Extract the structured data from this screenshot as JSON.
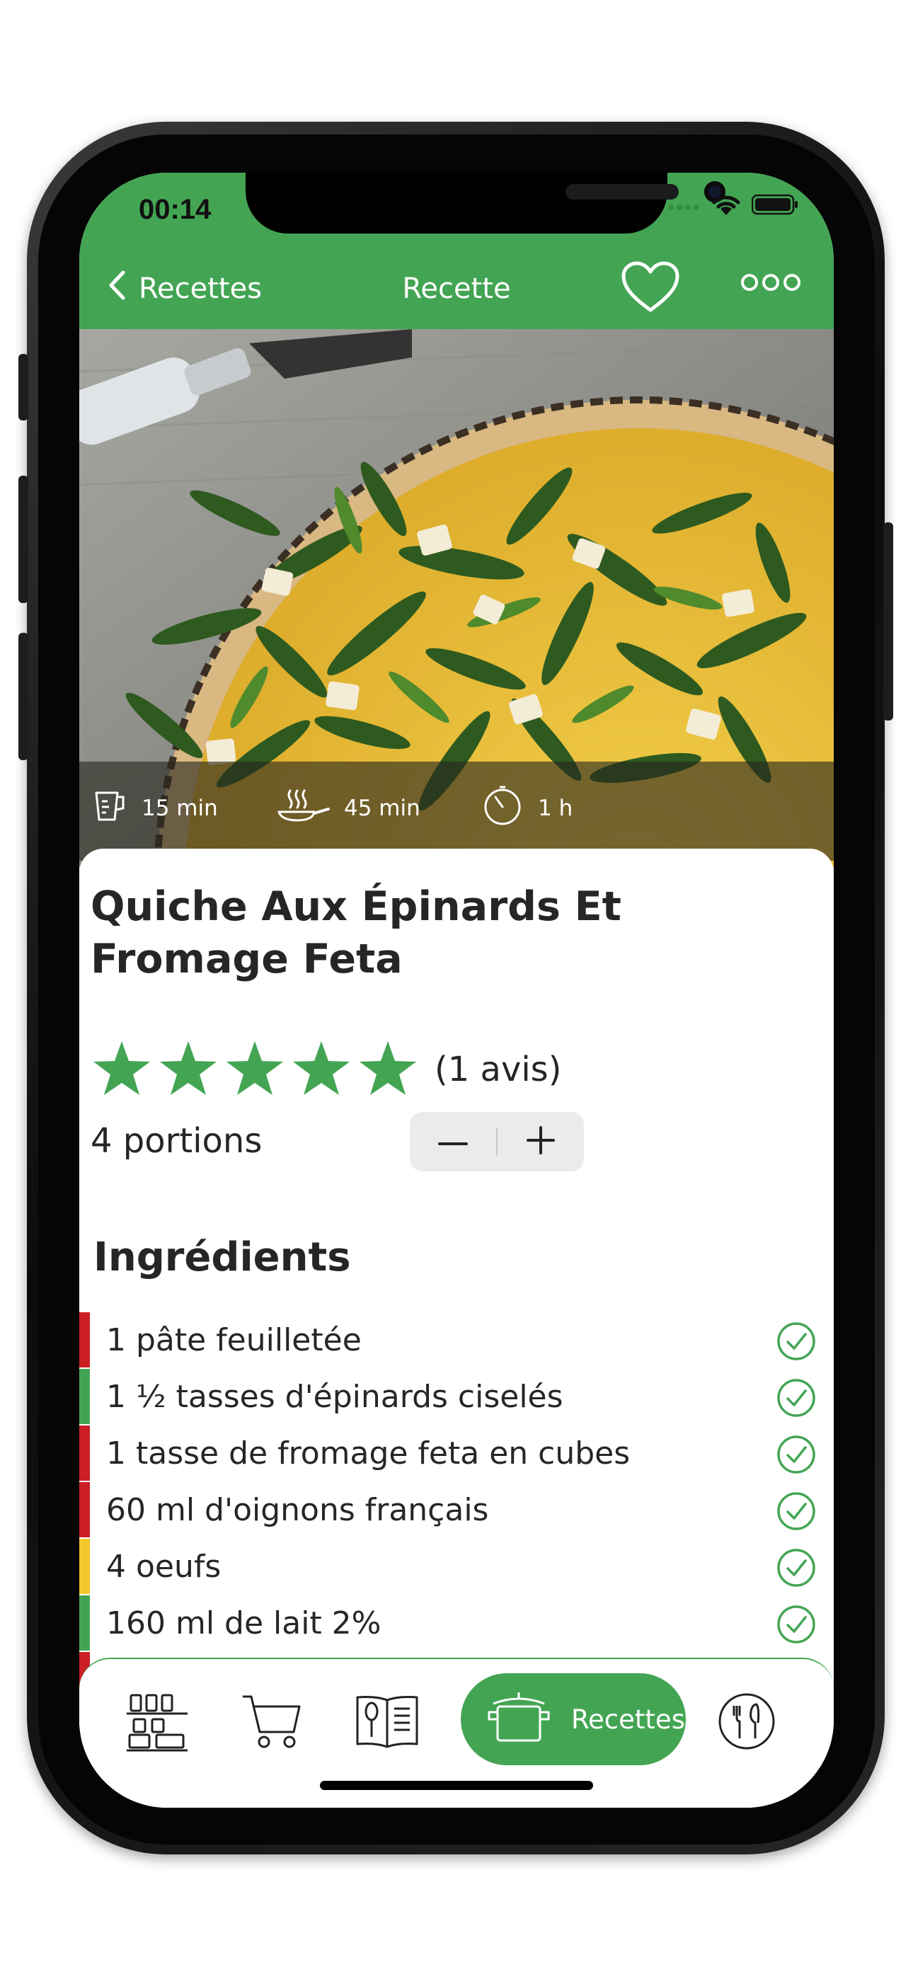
{
  "status_bar": {
    "time": "00:14"
  },
  "nav": {
    "back_label": "Recettes",
    "title": "Recette",
    "icons": {
      "back": "chevron-left-icon",
      "favorite": "heart-icon",
      "more": "ellipsis-icon"
    }
  },
  "hero": {
    "image": "spinach-feta-quiche-photo",
    "prep_time": "15 min",
    "cook_time": "45 min",
    "total_time": "1 h",
    "icons": {
      "prep": "measuring-cup-icon",
      "cook": "frying-pan-icon",
      "total": "timer-icon"
    }
  },
  "recipe": {
    "title": "Quiche Aux Épinards Et Fromage Feta",
    "rating": {
      "stars": 5,
      "max": 5,
      "reviews_label": "(1 avis)"
    },
    "portions_label": "4 portions"
  },
  "ingredients": {
    "title": "Ingrédients",
    "items": [
      {
        "text": "1 pâte feuilletée",
        "color": "#cc1f24"
      },
      {
        "text": "1 ½ tasses d'épinards ciselés",
        "color": "#43a553"
      },
      {
        "text": "1 tasse de fromage feta en cubes",
        "color": "#cc1f24"
      },
      {
        "text": "60 ml d'oignons français",
        "color": "#cc1f24"
      },
      {
        "text": "4 oeufs",
        "color": "#f2c62d"
      },
      {
        "text": "160 ml de lait 2%",
        "color": "#43a553"
      },
      {
        "text": "",
        "color": "#cc1f24"
      }
    ]
  },
  "tabbar": {
    "items": [
      {
        "name": "pantry-icon"
      },
      {
        "name": "cart-icon"
      },
      {
        "name": "cookbook-icon"
      },
      {
        "name": "pot-icon",
        "label": "Recettes",
        "active": true
      },
      {
        "name": "plate-cutlery-icon"
      }
    ]
  },
  "colors": {
    "brand_green": "#43a553",
    "text_dark": "#262626",
    "red_marker": "#cc1f24",
    "yellow_marker": "#f2c62d"
  }
}
